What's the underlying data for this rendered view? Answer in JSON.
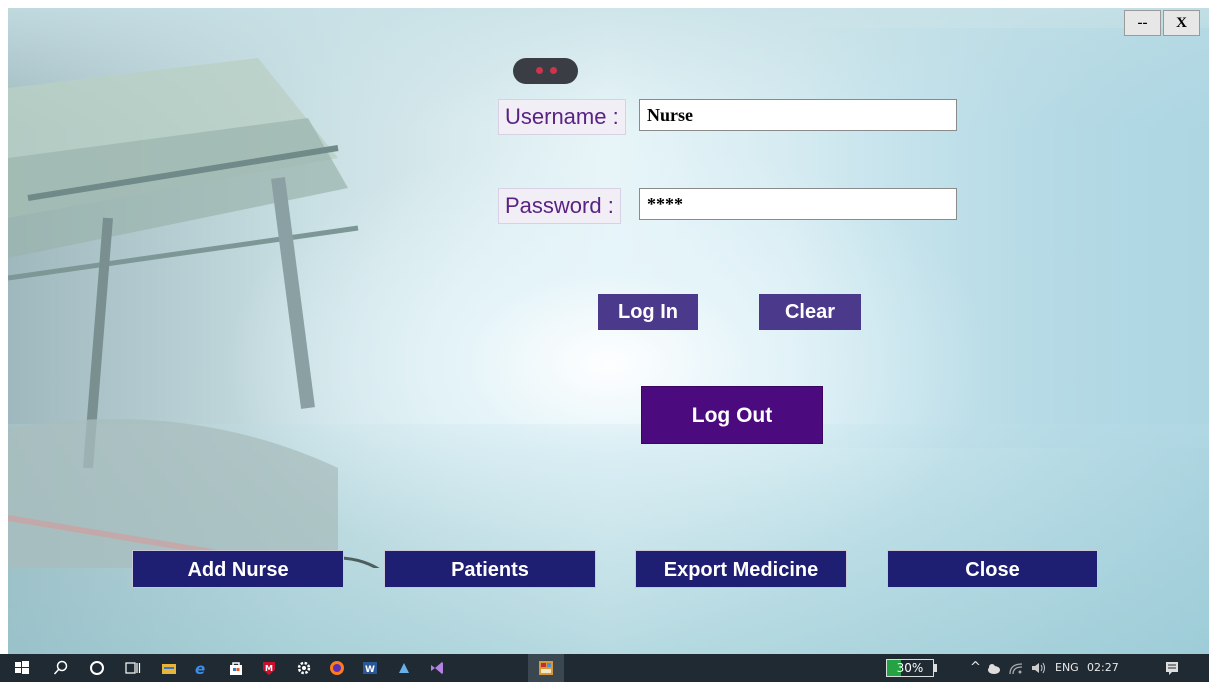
{
  "window": {
    "minimize_label": "--",
    "close_label": "X"
  },
  "login": {
    "username_label": "Username :",
    "username_value": "Nurse",
    "password_label": "Password :",
    "password_value": "****",
    "login_button": "Log In",
    "clear_button": "Clear",
    "logout_button": "Log Out"
  },
  "nav": {
    "add_nurse": "Add Nurse",
    "patients": "Patients",
    "export_medicine": "Export Medicine",
    "close": "Close"
  },
  "taskbar": {
    "battery_text": "30%",
    "battery_percent": 30,
    "language": "ENG",
    "time": "02:27",
    "icons": [
      "windows-start-icon",
      "search-icon",
      "cortana-icon",
      "task-view-icon",
      "file-explorer-icon",
      "edge-icon",
      "store-icon",
      "mcafee-icon",
      "settings-icon",
      "firefox-icon",
      "word-icon",
      "app-icon",
      "visual-studio-icon",
      "running-app-icon"
    ]
  },
  "colors": {
    "label_text": "#5a2383",
    "small_button": "#4b3a8c",
    "logout_button": "#4b0a7e",
    "nav_button": "#1e1e72",
    "taskbar": "#1f2a33",
    "battery_fill": "#25a244"
  }
}
